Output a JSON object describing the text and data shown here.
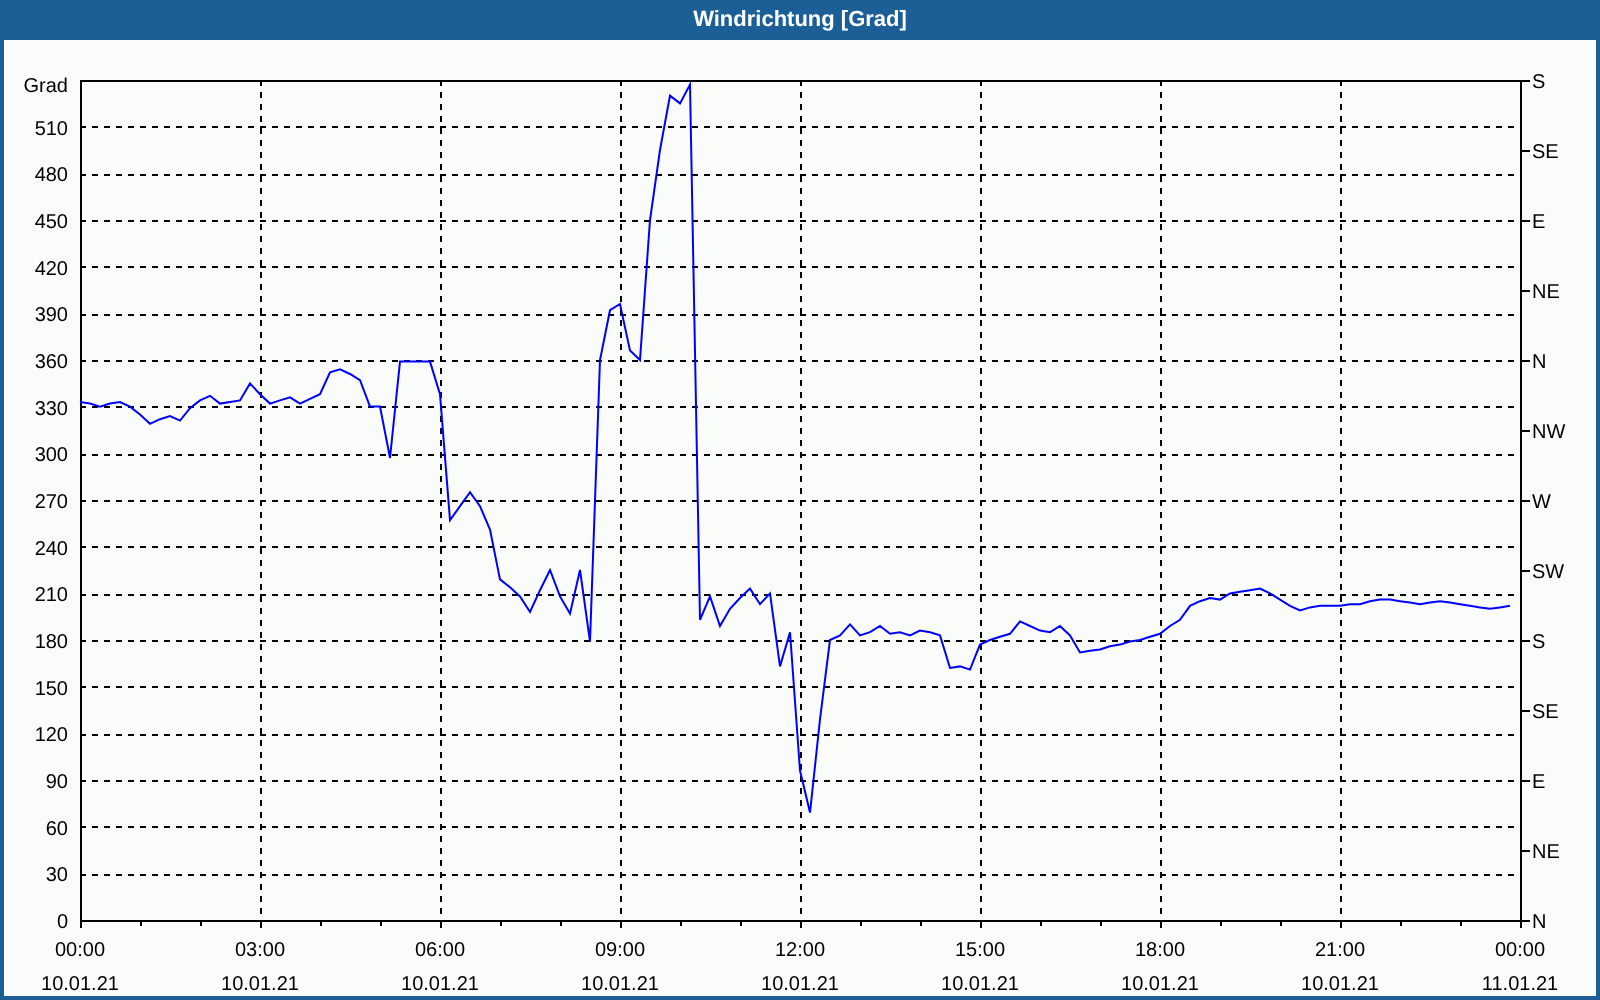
{
  "window": {
    "title": "Windrichtung [Grad]"
  },
  "chart": {
    "right_axis_labels": [
      "S",
      "SE",
      "E",
      "NE",
      "N",
      "NW",
      "W",
      "SW",
      "S",
      "SE",
      "E",
      "NE",
      "N"
    ],
    "chart_data": {
      "type": "line",
      "grid": true,
      "ylabel": "Grad",
      "ylim": [
        0,
        540
      ],
      "yticks": [
        0,
        30,
        60,
        90,
        120,
        150,
        180,
        210,
        240,
        270,
        300,
        330,
        360,
        390,
        420,
        450,
        480,
        510
      ],
      "categories": [
        "00:00\n10.01.21",
        null,
        null,
        null,
        null,
        null,
        null,
        null,
        null,
        null,
        null,
        null,
        null,
        null,
        null,
        null,
        null,
        null,
        "03:00\n10.01.21",
        null,
        null,
        null,
        null,
        null,
        null,
        null,
        null,
        null,
        null,
        null,
        null,
        null,
        null,
        null,
        null,
        null,
        "06:00\n10.01.21",
        null,
        null,
        null,
        null,
        null,
        null,
        null,
        null,
        null,
        null,
        null,
        null,
        null,
        null,
        null,
        null,
        null,
        "09:00\n10.01.21",
        null,
        null,
        null,
        null,
        null,
        null,
        null,
        null,
        null,
        null,
        null,
        null,
        null,
        null,
        null,
        null,
        null,
        "12:00\n10.01.21",
        null,
        null,
        null,
        null,
        null,
        null,
        null,
        null,
        null,
        null,
        null,
        null,
        null,
        null,
        null,
        null,
        null,
        "15:00\n10.01.21",
        null,
        null,
        null,
        null,
        null,
        null,
        null,
        null,
        null,
        null,
        null,
        null,
        null,
        null,
        null,
        null,
        null,
        "18:00\n10.01.21",
        null,
        null,
        null,
        null,
        null,
        null,
        null,
        null,
        null,
        null,
        null,
        null,
        null,
        null,
        null,
        null,
        null,
        "21:00\n10.01.21",
        null,
        null,
        null,
        null,
        null,
        null,
        null,
        null,
        null,
        null,
        null,
        null,
        null,
        null,
        null,
        null,
        null,
        "00:00\n11.01.21"
      ],
      "series": [
        {
          "color": "#0000ff",
          "values": [
            333,
            332,
            330,
            332,
            333,
            330,
            325,
            319,
            322,
            324,
            321,
            329,
            334,
            337,
            332,
            333,
            334,
            345,
            338,
            332,
            334,
            336,
            332,
            335,
            338,
            352,
            354,
            351,
            347,
            330,
            330,
            297,
            359,
            359,
            359,
            359,
            338,
            257,
            266,
            275,
            266,
            251,
            219,
            214,
            208,
            198,
            212,
            225,
            208,
            197,
            225,
            179,
            360,
            392,
            396,
            366,
            360,
            450,
            495,
            530,
            525,
            537,
            193,
            208,
            189,
            200,
            207,
            213,
            203,
            210,
            163,
            185,
            96,
            69,
            129,
            180,
            183,
            190,
            183,
            185,
            189,
            184,
            185,
            183,
            186,
            185,
            183,
            162,
            163,
            161,
            177,
            180,
            182,
            184,
            192,
            189,
            186,
            185,
            189,
            183,
            172,
            173,
            174,
            176,
            177,
            179,
            180,
            182,
            184,
            189,
            193,
            202,
            205,
            207,
            206,
            210,
            211,
            212,
            213,
            210,
            206,
            202,
            199,
            201,
            202,
            202,
            202,
            203,
            203,
            205,
            206,
            206,
            205,
            204,
            203,
            204,
            205,
            204,
            203,
            202,
            201,
            200,
            201,
            202,
            null
          ]
        }
      ]
    }
  }
}
